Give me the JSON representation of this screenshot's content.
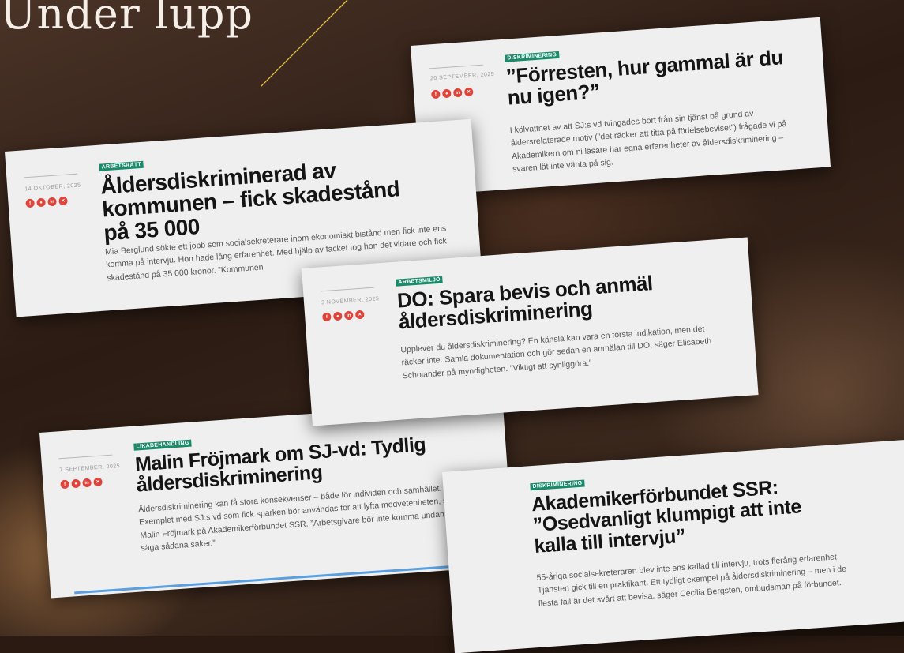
{
  "heading": "Under lupp",
  "cards": [
    {
      "date": "20 SEPTEMBER, 2025",
      "tag": "DISKRIMINERING",
      "title": "”Förresten, hur gammal är du nu igen?”",
      "text": "I kölvattnet av att SJ:s vd tvingades bort från sin tjänst på grund av åldersrelaterade motiv (”det räcker att titta på födelsebeviset”) frågade vi på Akademikern om ni läsare har egna erfarenheter av åldersdiskriminering – svaren lät inte vänta på sig."
    },
    {
      "date": "14 OKTOBER, 2025",
      "tag": "ARBETSRÄTT",
      "title": "Åldersdiskriminerad av kommunen – fick skadestånd på 35 000",
      "text": "Mia Berglund sökte ett jobb som socialsekreterare inom ekonomiskt bistånd men fick inte ens komma på intervju. Hon hade lång erfarenhet. Med hjälp av facket tog hon det vidare och fick skadestånd på 35 000 kronor. ”Kommunen"
    },
    {
      "date": "3 NOVEMBER, 2025",
      "tag": "ARBETSMILJÖ",
      "title": "DO: Spara bevis och anmäl åldersdiskriminering",
      "text": "Upplever du åldersdiskriminering? En känsla kan vara en första indikation, men det räcker inte. Samla dokumentation och gör sedan en anmälan till DO, säger Elisabeth Scholander på myndigheten. ”Viktigt att synliggöra.”"
    },
    {
      "date": "7 SEPTEMBER, 2025",
      "tag": "LIKABEHANDLING",
      "title": "Malin Fröjmark om SJ-vd: Tydlig åldersdiskriminering",
      "text": "Åldersdiskriminering kan få stora konsekvenser – både för individen och samhället. Exemplet med SJ:s vd som fick sparken bör användas för att lyfta medvetenheten, säger Malin Fröjmark på Akademikerförbundet SSR. ”Arbetsgivare bör inte komma undan med att säga sådana saker.”"
    },
    {
      "date": "",
      "tag": "DISKRIMINERING",
      "title": "Akademikerförbundet SSR: ”Osedvanligt klumpigt att inte kalla till intervju”",
      "text": "55-åriga socialsekreteraren blev inte ens kallad till intervju, trots flerårig erfarenhet. Tjänsten gick till en praktikant. Ett tydligt exempel på åldersdiskriminering – men i de flesta fall är det svårt att bevisa, säger Cecilia Bergsten, ombudsman på förbundet."
    }
  ],
  "share_icons": [
    "facebook-icon",
    "messenger-icon",
    "linkedin-icon",
    "x-icon"
  ],
  "colors": {
    "share": "#e0433a",
    "tag": "#1a8a6a",
    "accent": "#e8c24a"
  }
}
